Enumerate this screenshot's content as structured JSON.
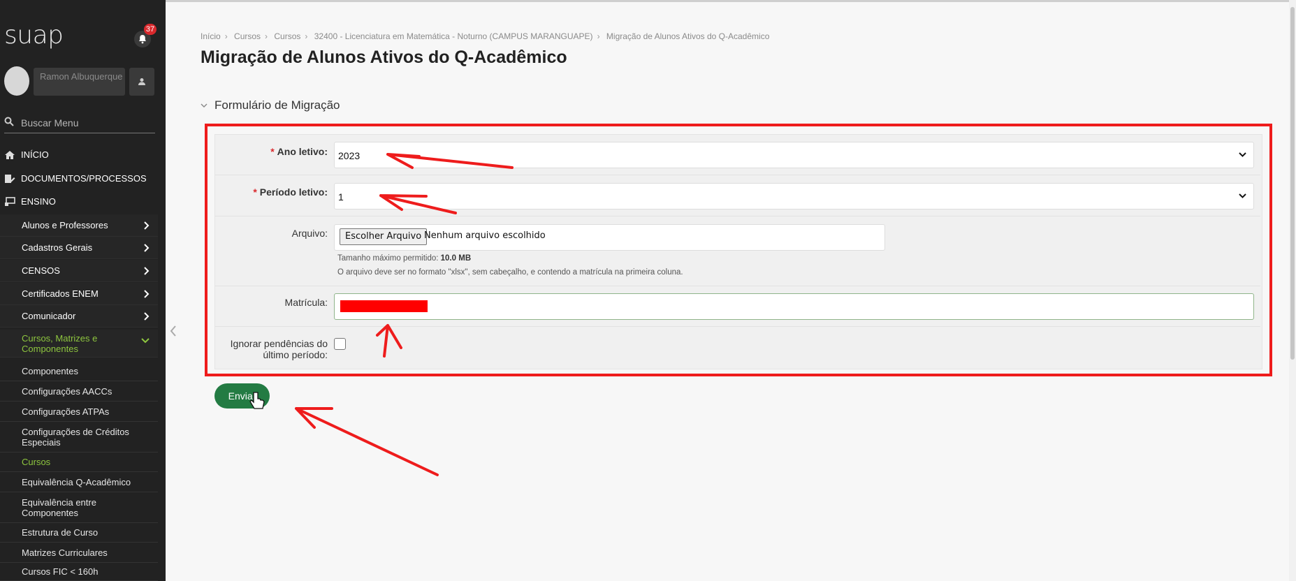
{
  "app": {
    "logo": "suap",
    "notifications": "37"
  },
  "user": {
    "name": "Ramon Albuquerque"
  },
  "search": {
    "placeholder": "Buscar Menu"
  },
  "menu": {
    "top": [
      {
        "label": "INÍCIO",
        "icon": "home-icon"
      },
      {
        "label": "DOCUMENTOS/PROCESSOS",
        "icon": "document-edit-icon"
      },
      {
        "label": "ENSINO",
        "icon": "classroom-icon"
      }
    ],
    "ensino_items": [
      {
        "label": "Alunos e Professores"
      },
      {
        "label": "Cadastros Gerais"
      },
      {
        "label": "CENSOS"
      },
      {
        "label": "Certificados ENEM"
      },
      {
        "label": "Comunicador"
      },
      {
        "label": "Cursos, Matrizes e Componentes"
      }
    ],
    "cursos_items": [
      {
        "label": "Componentes"
      },
      {
        "label": "Configurações AACCs"
      },
      {
        "label": "Configurações ATPAs"
      },
      {
        "label": "Configurações de Créditos Especiais"
      },
      {
        "label": "Cursos"
      },
      {
        "label": "Equivalência Q-Acadêmico"
      },
      {
        "label": "Equivalência entre Componentes"
      },
      {
        "label": "Estrutura de Curso"
      },
      {
        "label": "Matrizes Curriculares"
      },
      {
        "label": "Cursos FIC < 160h"
      }
    ]
  },
  "breadcrumb": [
    "Início",
    "Cursos",
    "Cursos",
    "32400 - Licenciatura em Matemática - Noturno (CAMPUS MARANGUAPE)",
    "Migração de Alunos Ativos do Q-Acadêmico"
  ],
  "page": {
    "title": "Migração de Alunos Ativos do Q-Acadêmico"
  },
  "form": {
    "fieldset": "Formulário de Migração",
    "required_mark": "*",
    "ano_label": "Ano letivo:",
    "ano_value": "2023",
    "periodo_label": "Período letivo:",
    "periodo_value": "1",
    "arquivo_label": "Arquivo:",
    "file_button": "Escolher Arquivo",
    "file_status": "Nenhum arquivo escolhido",
    "help_size_prefix": "Tamanho máximo permitido:",
    "help_size_value": "10.0 MB",
    "help_format": "O arquivo deve ser no formato \"xlsx\", sem cabeçalho, e contendo a matrícula na primeira coluna.",
    "matricula_label": "Matrícula:",
    "ignorar_label": "Ignorar pendências do último período:",
    "ignorar_checked": false,
    "submit": "Enviar"
  },
  "colors": {
    "sidebar": "#222222",
    "accent_green": "#8ec63f",
    "button": "#237b43",
    "annotation": "#ee1c1c"
  }
}
